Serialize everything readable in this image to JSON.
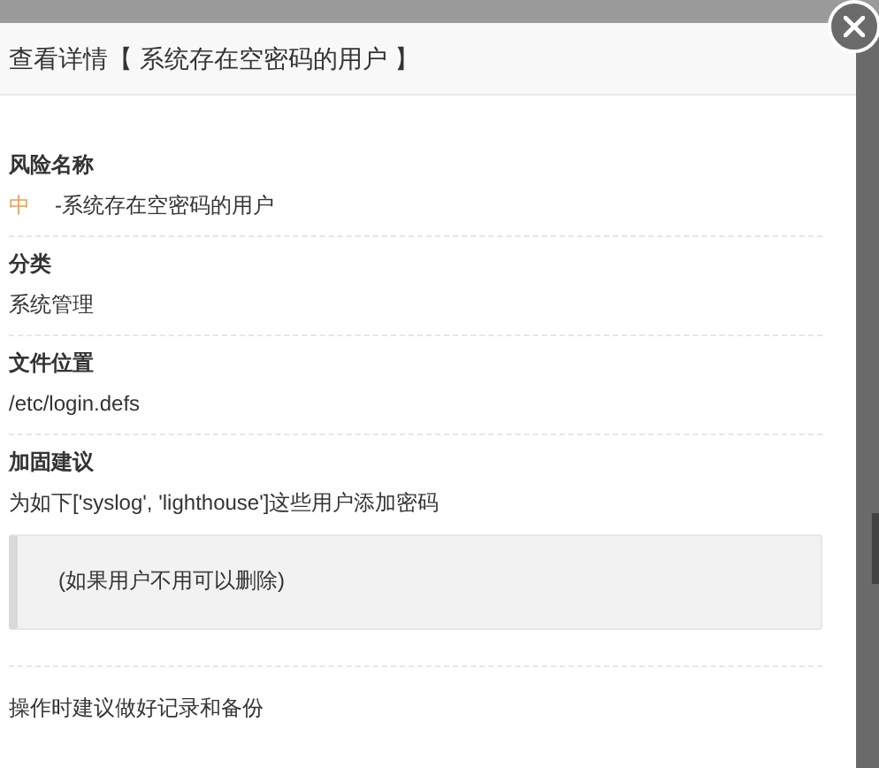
{
  "dialog": {
    "title": "查看详情【 系统存在空密码的用户 】"
  },
  "sections": [
    {
      "kind": "risk",
      "label": "风险名称",
      "level": {
        "text": "中",
        "color": "#f0a04b"
      },
      "value": "-系统存在空密码的用户"
    },
    {
      "kind": "plain",
      "label": "分类",
      "value": "系统管理"
    },
    {
      "kind": "plain",
      "label": "文件位置",
      "value": "/etc/login.defs"
    },
    {
      "kind": "advice",
      "label": "加固建议",
      "value": "为如下['syslog', 'lighthouse']这些用户添加密码",
      "note": "(如果用户不用可以删除)"
    },
    {
      "kind": "footnote",
      "value": "操作时建议做好记录和备份"
    }
  ]
}
